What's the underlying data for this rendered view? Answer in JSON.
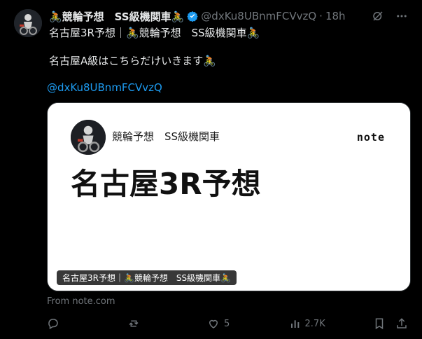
{
  "tweet": {
    "display_name": "🚴競輪予想　SS級機関車🚴",
    "handle": "@dxKu8UBnmFCVvzQ",
    "separator": "·",
    "time": "18h",
    "text_line1": "名古屋3R予想｜🚴競輪予想　SS級機関車🚴",
    "text_line2": "名古屋A級はこちらだけいきます🚴",
    "mention": "@dxKu8UBnmFCVvzQ"
  },
  "card": {
    "author": "競輪予想　SS級機関車",
    "logo": "note",
    "title": "名古屋3R予想",
    "badge": "名古屋3R予想｜🚴競輪予想　SS級機関車🚴",
    "source": "From note.com"
  },
  "actions": {
    "reply_count": "",
    "retweet_count": "",
    "like_count": "5",
    "views_count": "2.7K"
  },
  "colors": {
    "background": "#000000",
    "text": "#e7e9ea",
    "muted": "#71767b",
    "link": "#1d9bf0",
    "verified": "#1d9bf0"
  },
  "icons": [
    "avatar",
    "verified-badge-icon",
    "grok-icon",
    "more-icon",
    "reply-icon",
    "retweet-icon",
    "like-icon",
    "views-icon",
    "bookmark-icon",
    "share-icon",
    "note-logo"
  ]
}
